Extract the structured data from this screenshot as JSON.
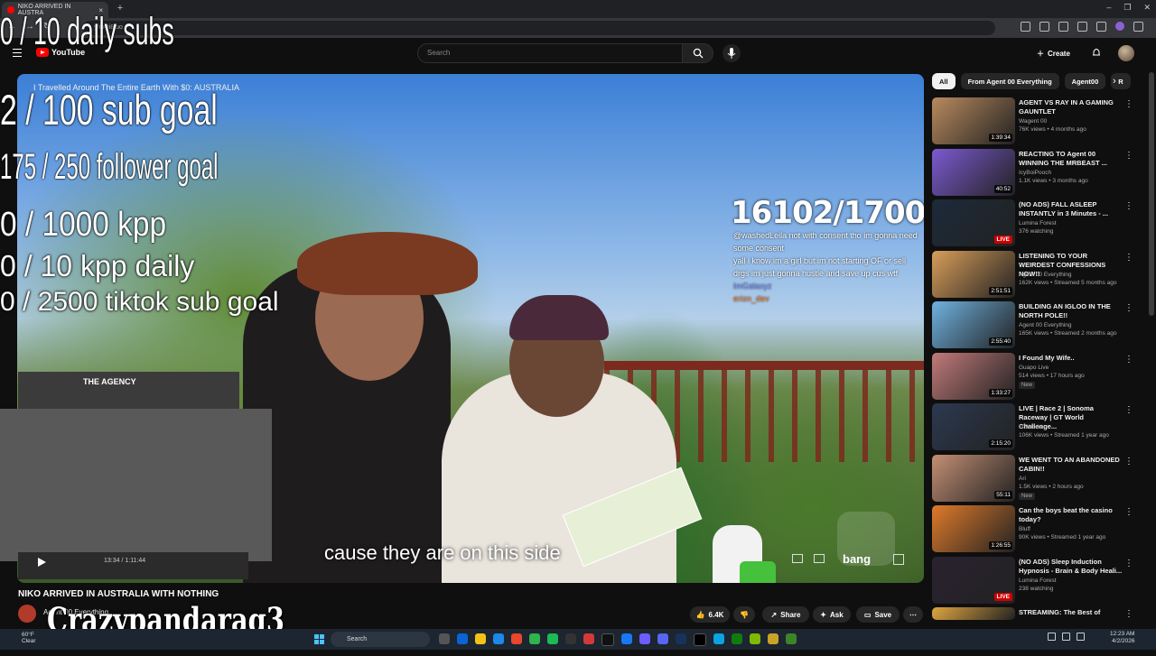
{
  "browser": {
    "tab_title": "NIKO ARRIVED IN AUSTRA",
    "url": "y/mQi8tuo"
  },
  "masthead": {
    "logo_text": "YouTube",
    "search_placeholder": "Search",
    "create_label": "Create"
  },
  "stream_overlay": {
    "goals": [
      "0 / 10 daily subs",
      "2  / 100 sub goal",
      "175 / 250 follower goal",
      "0 / 1000 kpp",
      "0 / 10 kpp daily",
      "0 / 2500 tiktok sub goal"
    ],
    "username": "Crazypandarag3",
    "counter": "16102/17000",
    "webcam_text": "THE AGENCY",
    "chat": [
      {
        "user": "",
        "text": "@washedLeila not with consent tho im gonna need some consent"
      },
      {
        "user": "",
        "text": "yall i know im a girl but im not starting OF or sell drgs im just gonna hustle and save up cus wtf"
      },
      {
        "user": "ImGalaxyz",
        "text": ""
      },
      {
        "user": "erion_dev",
        "text": ""
      }
    ]
  },
  "video": {
    "title_overlay": "I Travelled Around The Entire Earth With $0: AUSTRALIA",
    "caption": "cause they are on this side",
    "time": "13:34 / 1:11:44",
    "brand": "bang"
  },
  "watch": {
    "title": "NIKO ARRIVED IN AUSTRALIA WITH NOTHING",
    "channel": "Agent 00 Everything",
    "likes": "6.4K",
    "share": "Share",
    "ask": "Ask",
    "save": "Save"
  },
  "chips": [
    "All",
    "From Agent 00 Everything",
    "Agent00",
    "R"
  ],
  "recommendations": [
    {
      "title": "AGENT VS RAY IN A GAMING GAUNTLET",
      "channel": "Wagent 00",
      "meta": "76K views • 4 months ago",
      "badge": "1:39:34",
      "live": false,
      "new": ""
    },
    {
      "title": "REACTING TO Agent 00 WINNING THE MRBEAST ...",
      "channel": "IcyBoiPooch",
      "meta": "1.1K views • 3 months ago",
      "badge": "40:52",
      "live": false,
      "new": ""
    },
    {
      "title": "(NO ADS) FALL ASLEEP INSTANTLY in 3 Minutes - ...",
      "channel": "Lumina Forest",
      "meta": "376 watching",
      "badge": "LIVE",
      "live": true,
      "new": ""
    },
    {
      "title": "LISTENING TO YOUR WEIRDEST CONFESSIONS NOW!!",
      "channel": "Agent 00 Everything",
      "meta": "162K views • Streamed 5 months ago",
      "badge": "2:51:51",
      "live": false,
      "new": ""
    },
    {
      "title": "BUILDING AN IGLOO IN THE NORTH POLE!!",
      "channel": "Agent 00 Everything",
      "meta": "165K views • Streamed 2 months ago",
      "badge": "2:55:40",
      "live": false,
      "new": ""
    },
    {
      "title": "I Found My Wife..",
      "channel": "Guapo Live",
      "meta": "514 views • 17 hours ago",
      "badge": "1:33:27",
      "live": false,
      "new": "New"
    },
    {
      "title": "LIVE | Race 2 | Sonoma Raceway | GT World Challenge...",
      "channel": "GTWorld",
      "meta": "106K views • Streamed 1 year ago",
      "badge": "2:15:20",
      "live": false,
      "new": ""
    },
    {
      "title": "WE WENT TO AN ABANDONED CABIN!!",
      "channel": "Ari",
      "meta": "1.5K views • 2 hours ago",
      "badge": "55:11",
      "live": false,
      "new": "New"
    },
    {
      "title": "Can the boys beat the casino today?",
      "channel": "Bluff",
      "meta": "90K views • Streamed 1 year ago",
      "badge": "1:26:55",
      "live": false,
      "new": ""
    },
    {
      "title": "(NO ADS) Sleep Induction Hypnosis - Brain & Body Heali...",
      "channel": "Lumina Forest",
      "meta": "238 watching",
      "badge": "LIVE",
      "live": true,
      "new": ""
    },
    {
      "title": "STREAMING:  The Best of",
      "channel": "",
      "meta": "",
      "badge": "",
      "live": false,
      "new": ""
    }
  ],
  "taskbar": {
    "weather_temp": "60°F",
    "weather_desc": "Clear",
    "search_label": "Search",
    "time": "12:23 AM",
    "date": "4/2/2026"
  },
  "colors": {
    "youtube_red": "#ff0000",
    "background": "#0f0f0f",
    "chip_bg": "#272727"
  }
}
